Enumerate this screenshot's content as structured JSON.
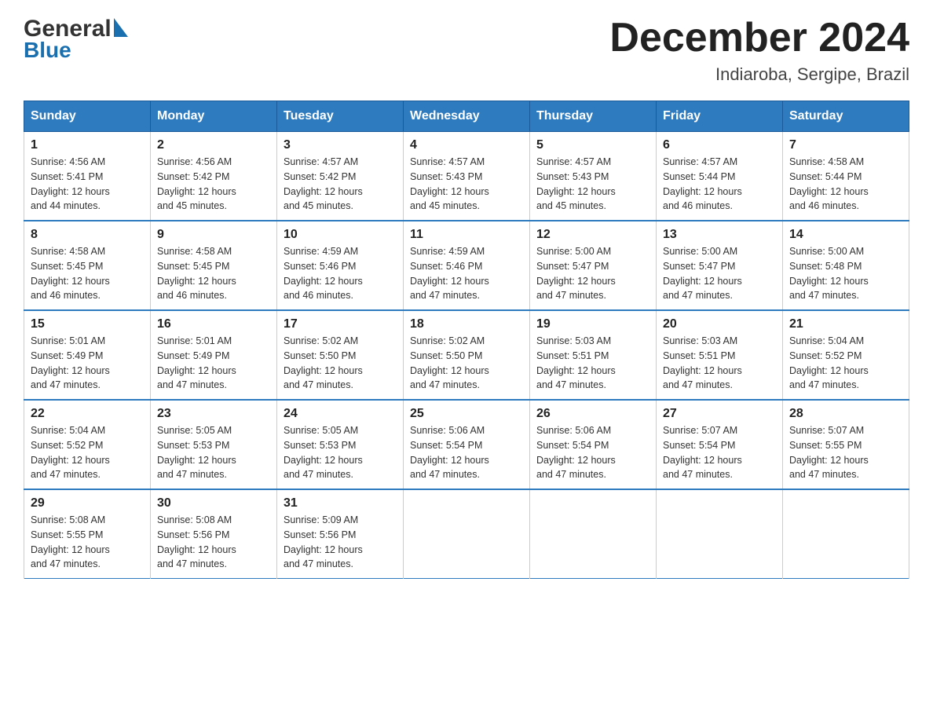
{
  "logo": {
    "general": "General",
    "blue": "Blue",
    "triangle": "▶"
  },
  "title": "December 2024",
  "subtitle": "Indiaroba, Sergipe, Brazil",
  "days_of_week": [
    "Sunday",
    "Monday",
    "Tuesday",
    "Wednesday",
    "Thursday",
    "Friday",
    "Saturday"
  ],
  "weeks": [
    [
      {
        "day": "1",
        "sunrise": "Sunrise: 4:56 AM",
        "sunset": "Sunset: 5:41 PM",
        "daylight": "Daylight: 12 hours",
        "daylight2": "and 44 minutes."
      },
      {
        "day": "2",
        "sunrise": "Sunrise: 4:56 AM",
        "sunset": "Sunset: 5:42 PM",
        "daylight": "Daylight: 12 hours",
        "daylight2": "and 45 minutes."
      },
      {
        "day": "3",
        "sunrise": "Sunrise: 4:57 AM",
        "sunset": "Sunset: 5:42 PM",
        "daylight": "Daylight: 12 hours",
        "daylight2": "and 45 minutes."
      },
      {
        "day": "4",
        "sunrise": "Sunrise: 4:57 AM",
        "sunset": "Sunset: 5:43 PM",
        "daylight": "Daylight: 12 hours",
        "daylight2": "and 45 minutes."
      },
      {
        "day": "5",
        "sunrise": "Sunrise: 4:57 AM",
        "sunset": "Sunset: 5:43 PM",
        "daylight": "Daylight: 12 hours",
        "daylight2": "and 45 minutes."
      },
      {
        "day": "6",
        "sunrise": "Sunrise: 4:57 AM",
        "sunset": "Sunset: 5:44 PM",
        "daylight": "Daylight: 12 hours",
        "daylight2": "and 46 minutes."
      },
      {
        "day": "7",
        "sunrise": "Sunrise: 4:58 AM",
        "sunset": "Sunset: 5:44 PM",
        "daylight": "Daylight: 12 hours",
        "daylight2": "and 46 minutes."
      }
    ],
    [
      {
        "day": "8",
        "sunrise": "Sunrise: 4:58 AM",
        "sunset": "Sunset: 5:45 PM",
        "daylight": "Daylight: 12 hours",
        "daylight2": "and 46 minutes."
      },
      {
        "day": "9",
        "sunrise": "Sunrise: 4:58 AM",
        "sunset": "Sunset: 5:45 PM",
        "daylight": "Daylight: 12 hours",
        "daylight2": "and 46 minutes."
      },
      {
        "day": "10",
        "sunrise": "Sunrise: 4:59 AM",
        "sunset": "Sunset: 5:46 PM",
        "daylight": "Daylight: 12 hours",
        "daylight2": "and 46 minutes."
      },
      {
        "day": "11",
        "sunrise": "Sunrise: 4:59 AM",
        "sunset": "Sunset: 5:46 PM",
        "daylight": "Daylight: 12 hours",
        "daylight2": "and 47 minutes."
      },
      {
        "day": "12",
        "sunrise": "Sunrise: 5:00 AM",
        "sunset": "Sunset: 5:47 PM",
        "daylight": "Daylight: 12 hours",
        "daylight2": "and 47 minutes."
      },
      {
        "day": "13",
        "sunrise": "Sunrise: 5:00 AM",
        "sunset": "Sunset: 5:47 PM",
        "daylight": "Daylight: 12 hours",
        "daylight2": "and 47 minutes."
      },
      {
        "day": "14",
        "sunrise": "Sunrise: 5:00 AM",
        "sunset": "Sunset: 5:48 PM",
        "daylight": "Daylight: 12 hours",
        "daylight2": "and 47 minutes."
      }
    ],
    [
      {
        "day": "15",
        "sunrise": "Sunrise: 5:01 AM",
        "sunset": "Sunset: 5:49 PM",
        "daylight": "Daylight: 12 hours",
        "daylight2": "and 47 minutes."
      },
      {
        "day": "16",
        "sunrise": "Sunrise: 5:01 AM",
        "sunset": "Sunset: 5:49 PM",
        "daylight": "Daylight: 12 hours",
        "daylight2": "and 47 minutes."
      },
      {
        "day": "17",
        "sunrise": "Sunrise: 5:02 AM",
        "sunset": "Sunset: 5:50 PM",
        "daylight": "Daylight: 12 hours",
        "daylight2": "and 47 minutes."
      },
      {
        "day": "18",
        "sunrise": "Sunrise: 5:02 AM",
        "sunset": "Sunset: 5:50 PM",
        "daylight": "Daylight: 12 hours",
        "daylight2": "and 47 minutes."
      },
      {
        "day": "19",
        "sunrise": "Sunrise: 5:03 AM",
        "sunset": "Sunset: 5:51 PM",
        "daylight": "Daylight: 12 hours",
        "daylight2": "and 47 minutes."
      },
      {
        "day": "20",
        "sunrise": "Sunrise: 5:03 AM",
        "sunset": "Sunset: 5:51 PM",
        "daylight": "Daylight: 12 hours",
        "daylight2": "and 47 minutes."
      },
      {
        "day": "21",
        "sunrise": "Sunrise: 5:04 AM",
        "sunset": "Sunset: 5:52 PM",
        "daylight": "Daylight: 12 hours",
        "daylight2": "and 47 minutes."
      }
    ],
    [
      {
        "day": "22",
        "sunrise": "Sunrise: 5:04 AM",
        "sunset": "Sunset: 5:52 PM",
        "daylight": "Daylight: 12 hours",
        "daylight2": "and 47 minutes."
      },
      {
        "day": "23",
        "sunrise": "Sunrise: 5:05 AM",
        "sunset": "Sunset: 5:53 PM",
        "daylight": "Daylight: 12 hours",
        "daylight2": "and 47 minutes."
      },
      {
        "day": "24",
        "sunrise": "Sunrise: 5:05 AM",
        "sunset": "Sunset: 5:53 PM",
        "daylight": "Daylight: 12 hours",
        "daylight2": "and 47 minutes."
      },
      {
        "day": "25",
        "sunrise": "Sunrise: 5:06 AM",
        "sunset": "Sunset: 5:54 PM",
        "daylight": "Daylight: 12 hours",
        "daylight2": "and 47 minutes."
      },
      {
        "day": "26",
        "sunrise": "Sunrise: 5:06 AM",
        "sunset": "Sunset: 5:54 PM",
        "daylight": "Daylight: 12 hours",
        "daylight2": "and 47 minutes."
      },
      {
        "day": "27",
        "sunrise": "Sunrise: 5:07 AM",
        "sunset": "Sunset: 5:54 PM",
        "daylight": "Daylight: 12 hours",
        "daylight2": "and 47 minutes."
      },
      {
        "day": "28",
        "sunrise": "Sunrise: 5:07 AM",
        "sunset": "Sunset: 5:55 PM",
        "daylight": "Daylight: 12 hours",
        "daylight2": "and 47 minutes."
      }
    ],
    [
      {
        "day": "29",
        "sunrise": "Sunrise: 5:08 AM",
        "sunset": "Sunset: 5:55 PM",
        "daylight": "Daylight: 12 hours",
        "daylight2": "and 47 minutes."
      },
      {
        "day": "30",
        "sunrise": "Sunrise: 5:08 AM",
        "sunset": "Sunset: 5:56 PM",
        "daylight": "Daylight: 12 hours",
        "daylight2": "and 47 minutes."
      },
      {
        "day": "31",
        "sunrise": "Sunrise: 5:09 AM",
        "sunset": "Sunset: 5:56 PM",
        "daylight": "Daylight: 12 hours",
        "daylight2": "and 47 minutes."
      },
      null,
      null,
      null,
      null
    ]
  ]
}
